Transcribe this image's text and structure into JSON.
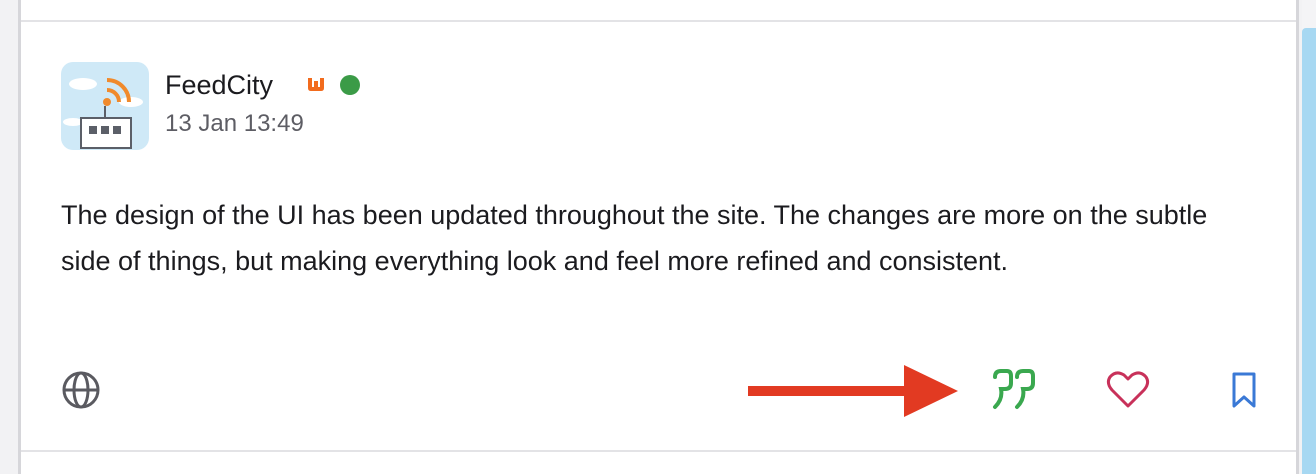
{
  "post": {
    "author": "FeedCity",
    "timestamp": "13 Jan 13:49",
    "body": "The design of the UI has been updated throughout the site. The changes are more on the subtle side of things, but making everything look and feel more refined and consistent.",
    "author_badge_icon": "w-badge-icon",
    "status": "online"
  },
  "actions": {
    "visibility_icon": "globe-icon",
    "quote_icon": "quote-icon",
    "like_icon": "heart-icon",
    "bookmark_icon": "bookmark-icon"
  },
  "annotation": {
    "icon": "red-arrow-icon"
  },
  "colors": {
    "quote": "#3aa84f",
    "like": "#c8315a",
    "bookmark": "#3a79d6",
    "online": "#3b9b47",
    "badge": "#f26b1d",
    "arrow": "#e23a22"
  }
}
